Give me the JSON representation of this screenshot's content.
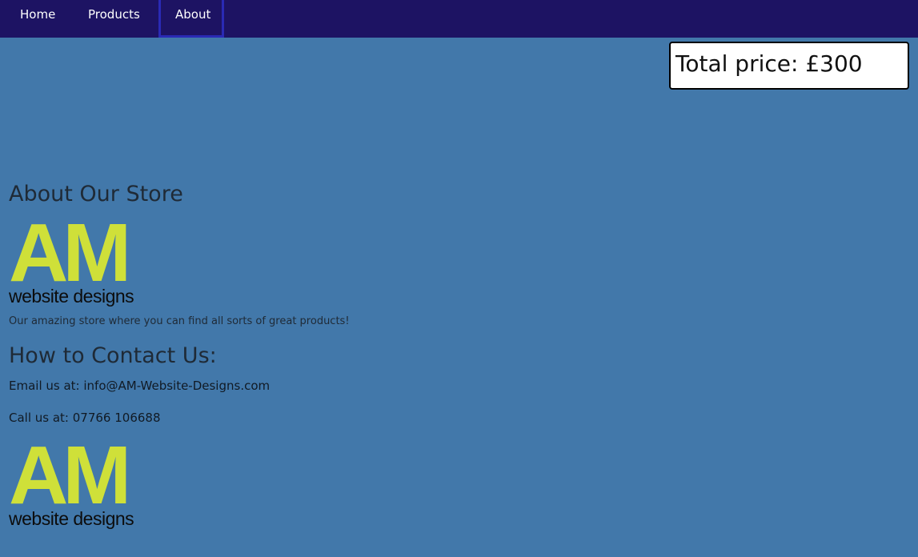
{
  "nav": {
    "items": [
      {
        "label": "Home"
      },
      {
        "label": "Products"
      },
      {
        "label": "About"
      }
    ]
  },
  "cart": {
    "total_label": "Total price: £300"
  },
  "about": {
    "heading": "About Our Store",
    "tagline": "Our amazing store where you can find all sorts of great products!"
  },
  "contact": {
    "heading": "How to Contact Us:",
    "email_line": "Email us at: info@AM-Website-Designs.com",
    "phone_line": "Call us at: 07766 106688"
  },
  "logo": {
    "mark": "AM",
    "subtitle": "website designs"
  },
  "colors": {
    "page_background": "#4278aa",
    "navbar_background": "#1d1363",
    "logo_accent": "#cfe039",
    "active_tab_border": "#2a2ab5"
  }
}
